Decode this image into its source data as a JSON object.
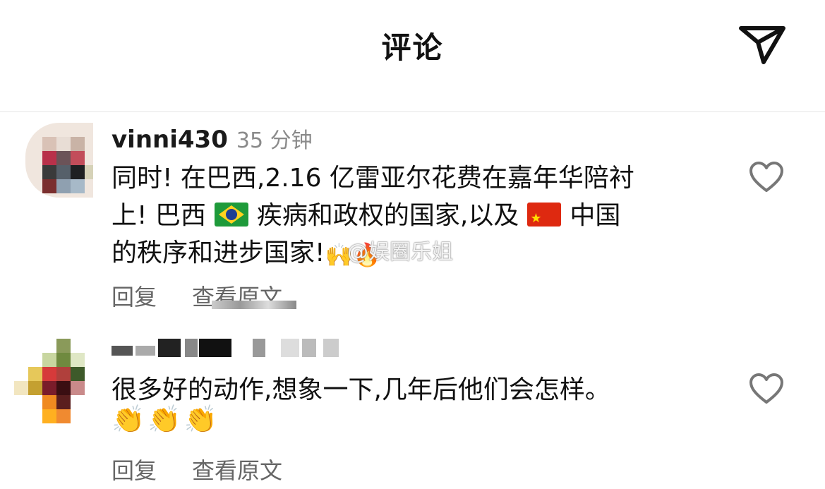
{
  "header": {
    "title": "评论",
    "share_icon": "send-icon"
  },
  "comments": [
    {
      "username": "vinni430",
      "time": "35 分钟",
      "text_line1": "同时! 在巴西,2.16 亿雷亚尔花费在嘉年华陪衬",
      "text_line2_a": "上! 巴西",
      "text_line2_b": "疾病和政权的国家,以及",
      "text_line2_c": "中国",
      "text_line3": "的秩序和进步国家!",
      "emojis": "🙌🔥",
      "watermark": "@娱圈乐姐",
      "reply_label": "回复",
      "view_original_label": "查看原文",
      "like_icon": "heart-icon"
    },
    {
      "username": "",
      "text_line1": "很多好的动作,想象一下,几年后他们会怎样。",
      "emojis": "👏👏👏",
      "reply_label": "回复",
      "view_original_label": "查看原文",
      "like_icon": "heart-icon"
    }
  ],
  "colors": {
    "text": "#111111",
    "muted": "#8a8a8a",
    "action": "#666666",
    "divider": "#e6e6e6"
  }
}
